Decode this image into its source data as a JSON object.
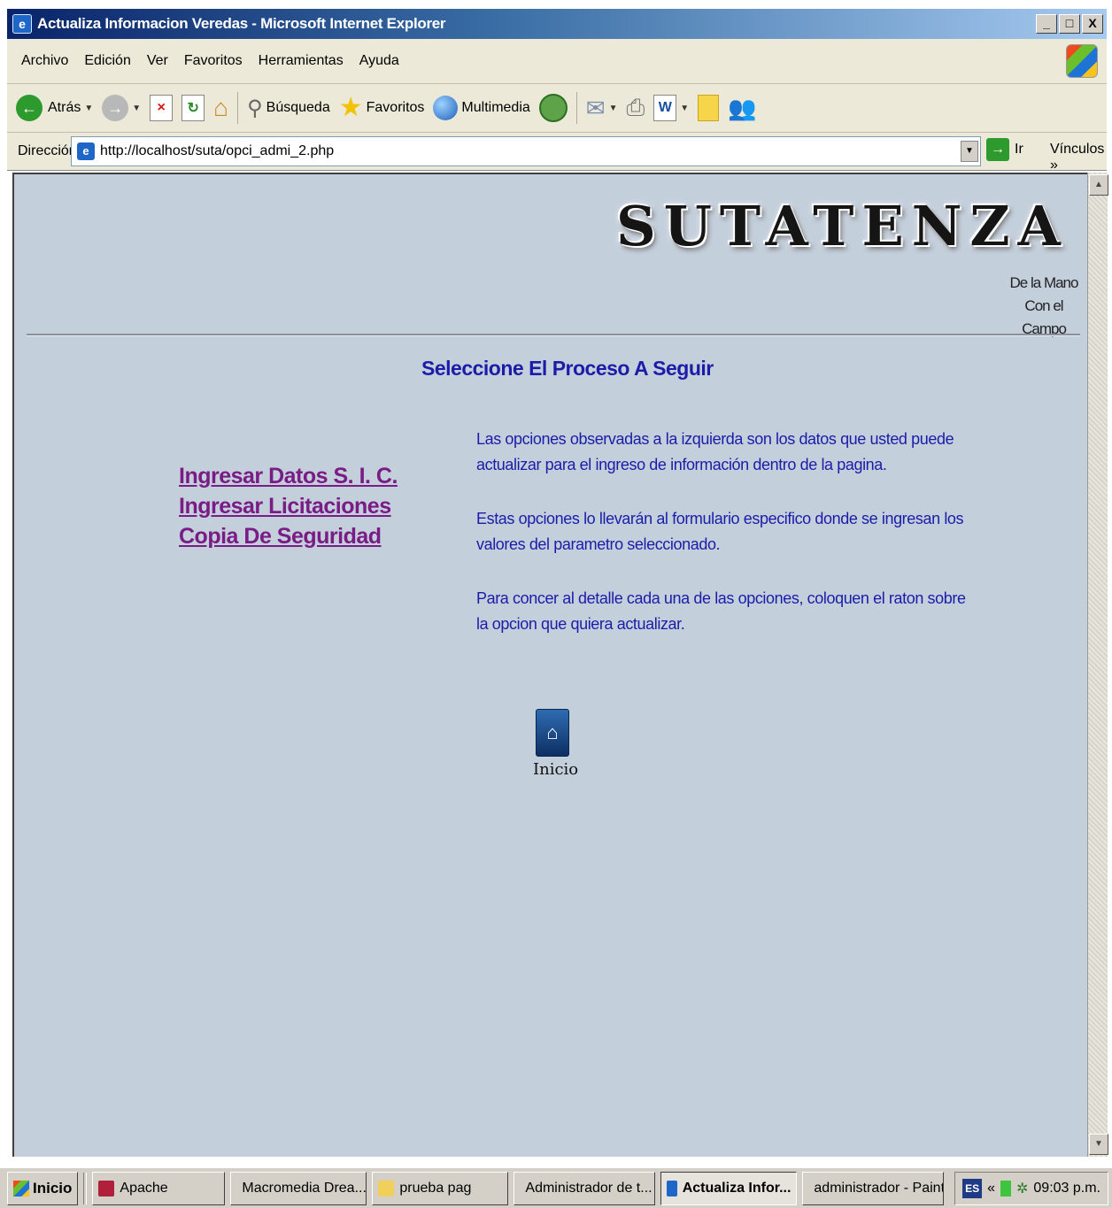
{
  "window": {
    "title": "Actualiza Informacion Veredas - Microsoft Internet Explorer",
    "controls": [
      "_",
      "□",
      "X"
    ]
  },
  "menu": [
    "Archivo",
    "Edición",
    "Ver",
    "Favoritos",
    "Herramientas",
    "Ayuda"
  ],
  "toolbar": {
    "back_label": "Atrás",
    "search_label": "Búsqueda",
    "favorites_label": "Favoritos",
    "media_label": "Multimedia"
  },
  "address": {
    "label": "Dirección",
    "url": "http://localhost/suta/opci_admi_2.php",
    "go_label": "Ir",
    "links_label": "Vínculos »"
  },
  "page": {
    "logo": "SUTATENZA",
    "tagline_line1": "De la Mano",
    "tagline_line2": "Con el Campo",
    "heading": "Seleccione El Proceso A Seguir",
    "options": [
      "Ingresar Datos S. I. C.",
      "Ingresar Licitaciones",
      "Copia De Seguridad"
    ],
    "paragraphs": [
      "Las opciones observadas a la izquierda son los datos que usted puede actualizar para el ingreso de información dentro de la pagina.",
      "Estas opciones lo llevarán al formulario especifico donde se ingresan los valores del parametro seleccionado.",
      "Para concer al detalle cada una de las opciones, coloquen el raton sobre la opcion que quiera actualizar."
    ],
    "home_label": "Inicio"
  },
  "taskbar": {
    "start_label": "Inicio",
    "tasks": [
      "Apache",
      "Macromedia Drea...",
      "prueba pag",
      "Administrador de t...",
      "Actualiza Infor...",
      "administrador - Paint"
    ],
    "language": "ES",
    "tray_chevron": "«",
    "clock": "09:03 p.m."
  },
  "colors": {
    "content_bg": "#c4cfdc",
    "heading_text": "#1c1ca8",
    "link_text": "#7a1c85",
    "titlebar_start": "#0a246a"
  }
}
